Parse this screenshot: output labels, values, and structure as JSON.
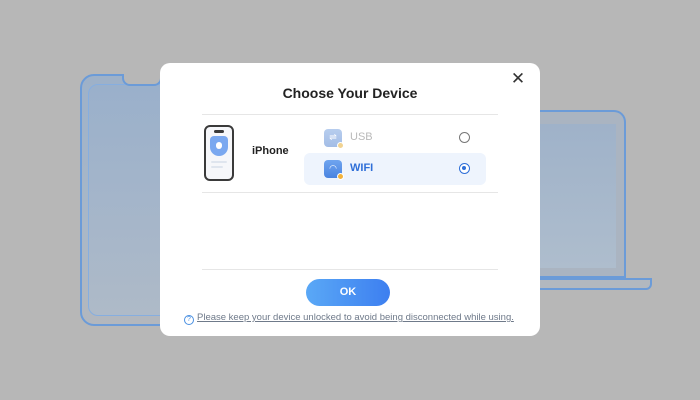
{
  "dialog": {
    "title": "Choose Your Device",
    "close_glyph": "✕",
    "device": {
      "name": "iPhone",
      "icon": "iphone-icon"
    },
    "connections": [
      {
        "label": "USB",
        "icon": "usb-icon",
        "selected": false
      },
      {
        "label": "WIFI",
        "icon": "wifi-icon",
        "selected": true
      }
    ],
    "ok_label": "OK",
    "hint_text": "Please keep your device unlocked to avoid being disconnected while using."
  },
  "colors": {
    "accent": "#2f6fd8",
    "button_gradient_start": "#5aa8f6",
    "button_gradient_end": "#3d7ff0",
    "overlay": "#b7b7b7"
  }
}
